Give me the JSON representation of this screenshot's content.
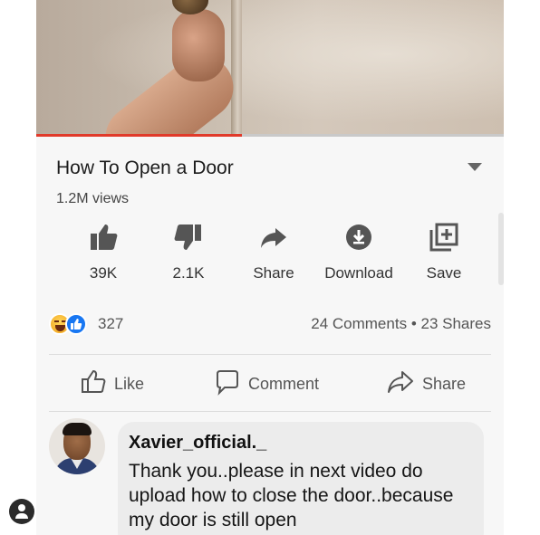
{
  "video": {
    "progress_fraction": 0.44
  },
  "header": {
    "title": "How To Open a Door",
    "views": "1.2M views"
  },
  "actions": [
    {
      "icon": "thumbs-up-icon",
      "label": "39K"
    },
    {
      "icon": "thumbs-down-icon",
      "label": "2.1K"
    },
    {
      "icon": "share-arrow-icon",
      "label": "Share"
    },
    {
      "icon": "download-icon",
      "label": "Download"
    },
    {
      "icon": "add-to-playlist-icon",
      "label": "Save"
    }
  ],
  "reactions": {
    "icons": [
      "haha-reaction-icon",
      "like-reaction-icon"
    ],
    "count": "327",
    "comments": "24 Comments",
    "separator": "•",
    "shares": "23 Shares"
  },
  "fb_actions": {
    "like": "Like",
    "comment": "Comment",
    "share": "Share"
  },
  "comment": {
    "author": "Xavier_official._",
    "text": "Thank you..please in next video do upload how to close the door..because my door is still open"
  },
  "colors": {
    "progress": "#e13a2a",
    "like_badge": "#1877f2",
    "background": "#f7f7f7",
    "bubble": "#ececec"
  }
}
